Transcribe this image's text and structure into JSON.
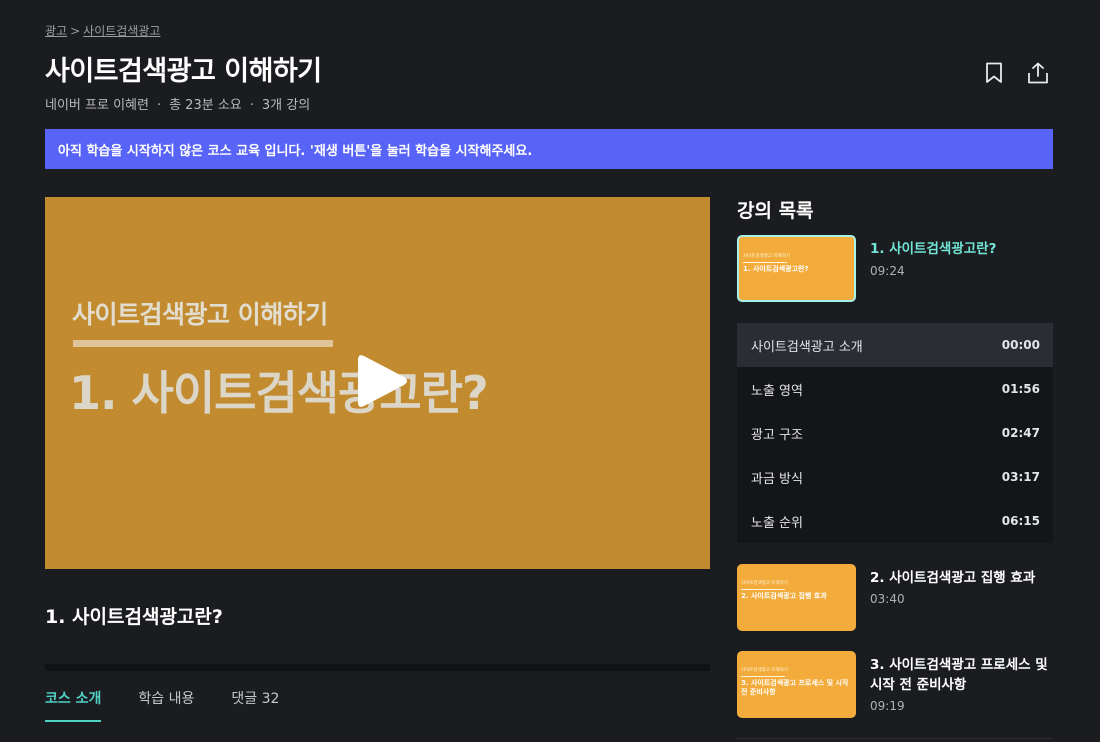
{
  "breadcrumb": {
    "items": [
      "광고",
      "사이트검색광고"
    ],
    "separator": ">"
  },
  "course": {
    "title": "사이트검색광고 이해하기",
    "author": "네이버 프로 이혜련",
    "duration": "총 23분 소요",
    "lecture_count": "3개 강의"
  },
  "actions": {
    "bookmark_icon": "bookmark-icon",
    "share_icon": "share-icon"
  },
  "notice": {
    "text": "아직 학습을 시작하지 않은 코스 교육 입니다. '재생 버튼'을 눌러 학습을 시작해주세요.",
    "color": "#5863f8"
  },
  "player": {
    "slide_subtitle": "사이트검색광고 이해하기",
    "slide_title": "1. 사이트검색광고란?",
    "play_icon": "play-icon",
    "background": "#c28b30"
  },
  "current_lesson": {
    "title": "1. 사이트검색광고란?"
  },
  "tabs": [
    {
      "label": "코스 소개",
      "active": true
    },
    {
      "label": "학습 내용",
      "active": false
    },
    {
      "label": "댓글 32",
      "active": false
    }
  ],
  "sidebar": {
    "title": "강의 목록",
    "accent": "#71e6d6",
    "lectures": [
      {
        "title": "1. 사이트검색광고란?",
        "duration": "09:24",
        "thumb_caption": "사이트검색광고 이해하기",
        "thumb_text": "1. 사이트검색광고란?",
        "active": true
      },
      {
        "title": "2. 사이트검색광고 집행 효과",
        "duration": "03:40",
        "thumb_caption": "사이트검색광고 이해하기",
        "thumb_text": "2. 사이트검색광고 집행 효과",
        "active": false
      },
      {
        "title": "3. 사이트검색광고 프로세스 및 시작 전 준비사항",
        "duration": "09:19",
        "thumb_caption": "사이트검색광고 이해하기",
        "thumb_text": "3. 사이트검색광고 프로세스 및 시작 전 준비사항",
        "active": false
      }
    ],
    "chapters": [
      {
        "label": "사이트검색광고 소개",
        "time": "00:00",
        "active": true
      },
      {
        "label": "노출 영역",
        "time": "01:56",
        "active": false
      },
      {
        "label": "광고 구조",
        "time": "02:47",
        "active": false
      },
      {
        "label": "과금 방식",
        "time": "03:17",
        "active": false
      },
      {
        "label": "노출 순위",
        "time": "06:15",
        "active": false
      }
    ]
  }
}
